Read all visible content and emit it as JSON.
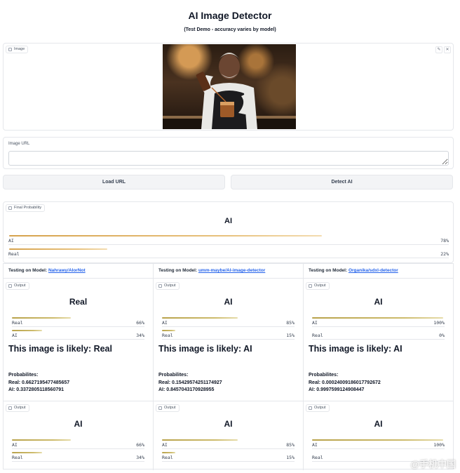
{
  "header": {
    "title": "AI Image Detector",
    "subtitle": "(Test Demo - accuracy varies by model)"
  },
  "image_panel": {
    "label": "Image",
    "edit_icon": "pencil-icon",
    "close_icon": "close-icon",
    "edit_glyph": "✎",
    "close_glyph": "✕"
  },
  "url_field": {
    "label": "Image URL",
    "value": "",
    "placeholder": ""
  },
  "buttons": {
    "load": "Load URL",
    "detect": "Detect AI"
  },
  "final": {
    "label": "Final Probability",
    "result": "AI",
    "rows": [
      {
        "label": "AI",
        "pct": "78%",
        "value": 0.78
      },
      {
        "label": "Real",
        "pct": "22%",
        "value": 0.22
      }
    ]
  },
  "models": [
    {
      "prefix": "Testing on Model: ",
      "name": "Nahrawy/AIorNot",
      "output_label": "Output",
      "result": "Real",
      "rows": [
        {
          "label": "Real",
          "pct": "66%",
          "value": 0.66
        },
        {
          "label": "AI",
          "pct": "34%",
          "value": 0.34
        }
      ],
      "likely": "This image is likely: Real",
      "probs_title": "Probabilites:",
      "probs_real": "Real: 0.6627195477485657",
      "probs_ai": "AI: 0.3372805118560791",
      "output2_label": "Output",
      "result2": "AI",
      "rows2": [
        {
          "label": "AI",
          "pct": "66%",
          "value": 0.66
        },
        {
          "label": "Real",
          "pct": "34%",
          "value": 0.34
        }
      ]
    },
    {
      "prefix": "Testing on Model: ",
      "name": "umm-maybe/AI-image-detector",
      "output_label": "Output",
      "result": "AI",
      "rows": [
        {
          "label": "AI",
          "pct": "85%",
          "value": 0.85
        },
        {
          "label": "Real",
          "pct": "15%",
          "value": 0.15
        }
      ],
      "likely": "This image is likely: AI",
      "probs_title": "Probabilites:",
      "probs_real": "Real: 0.15429574251174927",
      "probs_ai": "AI: 0.8457043170928955",
      "output2_label": "Output",
      "result2": "AI",
      "rows2": [
        {
          "label": "AI",
          "pct": "85%",
          "value": 0.85
        },
        {
          "label": "Real",
          "pct": "15%",
          "value": 0.15
        }
      ]
    },
    {
      "prefix": "Testing on Model: ",
      "name": "Organika/sdxl-detector",
      "output_label": "Output",
      "result": "AI",
      "rows": [
        {
          "label": "AI",
          "pct": "100%",
          "value": 1.0
        },
        {
          "label": "Real",
          "pct": "0%",
          "value": 0.0
        }
      ],
      "likely": "This image is likely: AI",
      "probs_title": "Probabilites:",
      "probs_real": "Real: 0.00024009186017792672",
      "probs_ai": "AI: 0.9997599124908447",
      "output2_label": "Output",
      "result2": "AI",
      "rows2": [
        {
          "label": "AI",
          "pct": "100%",
          "value": 1.0
        },
        {
          "label": "Real",
          "pct": "",
          "value": 0.0
        }
      ]
    }
  ],
  "watermark": "@手机中国",
  "colors": {
    "bar_orange": "#d6a24c",
    "bar_olive": "#b8a24a",
    "link": "#2563eb"
  }
}
